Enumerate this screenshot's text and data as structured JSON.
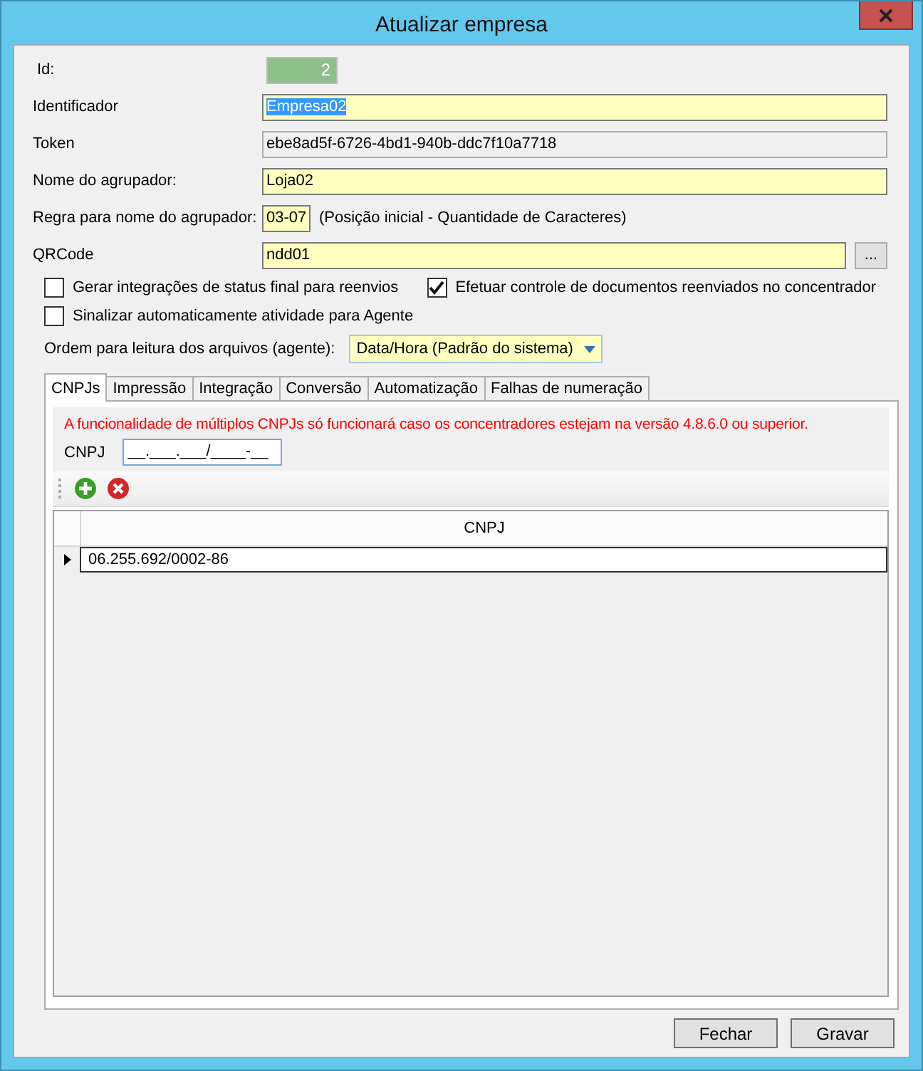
{
  "window": {
    "title": "Atualizar empresa"
  },
  "fields": [
    {
      "kind": "id",
      "label": "Id:",
      "value": "2"
    },
    {
      "kind": "selected",
      "label": "Identificador",
      "value": "Empresa02"
    },
    {
      "kind": "readonly",
      "label": "Token",
      "value": "ebe8ad5f-6726-4bd1-940b-ddc7f10a7718"
    },
    {
      "kind": "editable",
      "label": "Nome do agrupador:",
      "value": "Loja02"
    },
    {
      "kind": "short",
      "label": "Regra para nome do agrupador:",
      "value": "03-07",
      "note": "(Posição inicial - Quantidade de Caracteres)"
    },
    {
      "kind": "browse",
      "label": "QRCode",
      "value": "ndd01",
      "button": "..."
    }
  ],
  "checkbox_rows": [
    {
      "items": [
        {
          "label": "Gerar integrações de status final para reenvios",
          "checked": false
        },
        {
          "label": "Efetuar controle de documentos reenviados no concentrador",
          "checked": true
        }
      ]
    },
    {
      "items": [
        {
          "label": "Sinalizar automaticamente atividade para Agente",
          "checked": false
        }
      ]
    }
  ],
  "order": {
    "label": "Ordem para leitura dos arquivos (agente):",
    "value": "Data/Hora (Padrão do sistema)"
  },
  "tabs": [
    {
      "label": "CNPJs",
      "selected": true
    },
    {
      "label": "Impressão",
      "selected": false
    },
    {
      "label": "Integração",
      "selected": false
    },
    {
      "label": "Conversão",
      "selected": false
    },
    {
      "label": "Automatização",
      "selected": false
    },
    {
      "label": "Falhas de numeração",
      "selected": false
    }
  ],
  "cnpj_panel": {
    "warning": "A funcionalidade de múltiplos CNPJs só funcionará caso os concentradores estejam na versão 4.8.6.0 ou superior.",
    "field_label": "CNPJ",
    "field_value": "__.___.___/____-__",
    "table": {
      "columns": [
        "CNPJ"
      ],
      "rows": [
        {
          "cells": [
            "06.255.692/0002-86"
          ],
          "selected": true
        }
      ]
    }
  },
  "buttons": [
    "Fechar",
    "Gravar"
  ]
}
